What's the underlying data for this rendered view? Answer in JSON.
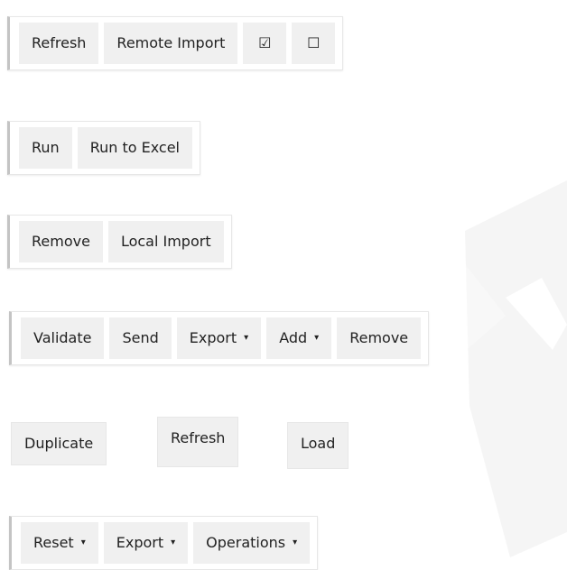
{
  "rows": [
    {
      "buttons": [
        {
          "label": "Refresh"
        },
        {
          "label": "Remote Import"
        },
        {
          "label": "☑"
        },
        {
          "label": "☐"
        }
      ]
    },
    {
      "buttons": [
        {
          "label": "Run"
        },
        {
          "label": "Run to Excel"
        }
      ]
    },
    {
      "buttons": [
        {
          "label": "Remove"
        },
        {
          "label": "Local Import"
        }
      ]
    },
    {
      "buttons": [
        {
          "label": "Validate"
        },
        {
          "label": "Send"
        },
        {
          "label": "Export",
          "caret": "▾"
        },
        {
          "label": "Add",
          "caret": "▾"
        },
        {
          "label": "Remove"
        }
      ]
    },
    {
      "buttons": [
        {
          "label": "Duplicate"
        },
        {
          "label": "Refresh"
        },
        {
          "label": "Load"
        }
      ]
    },
    {
      "buttons": [
        {
          "label": "Reset",
          "caret": "▾"
        },
        {
          "label": "Export",
          "caret": "▾"
        },
        {
          "label": "Operations",
          "caret": "▾"
        }
      ]
    }
  ],
  "colors": {
    "button_background": "#f0f0f0",
    "toolbar_border": "#c4c4c4",
    "watermark": "#f0f0f0"
  },
  "watermark": {
    "icon": "watermark-stroke"
  }
}
